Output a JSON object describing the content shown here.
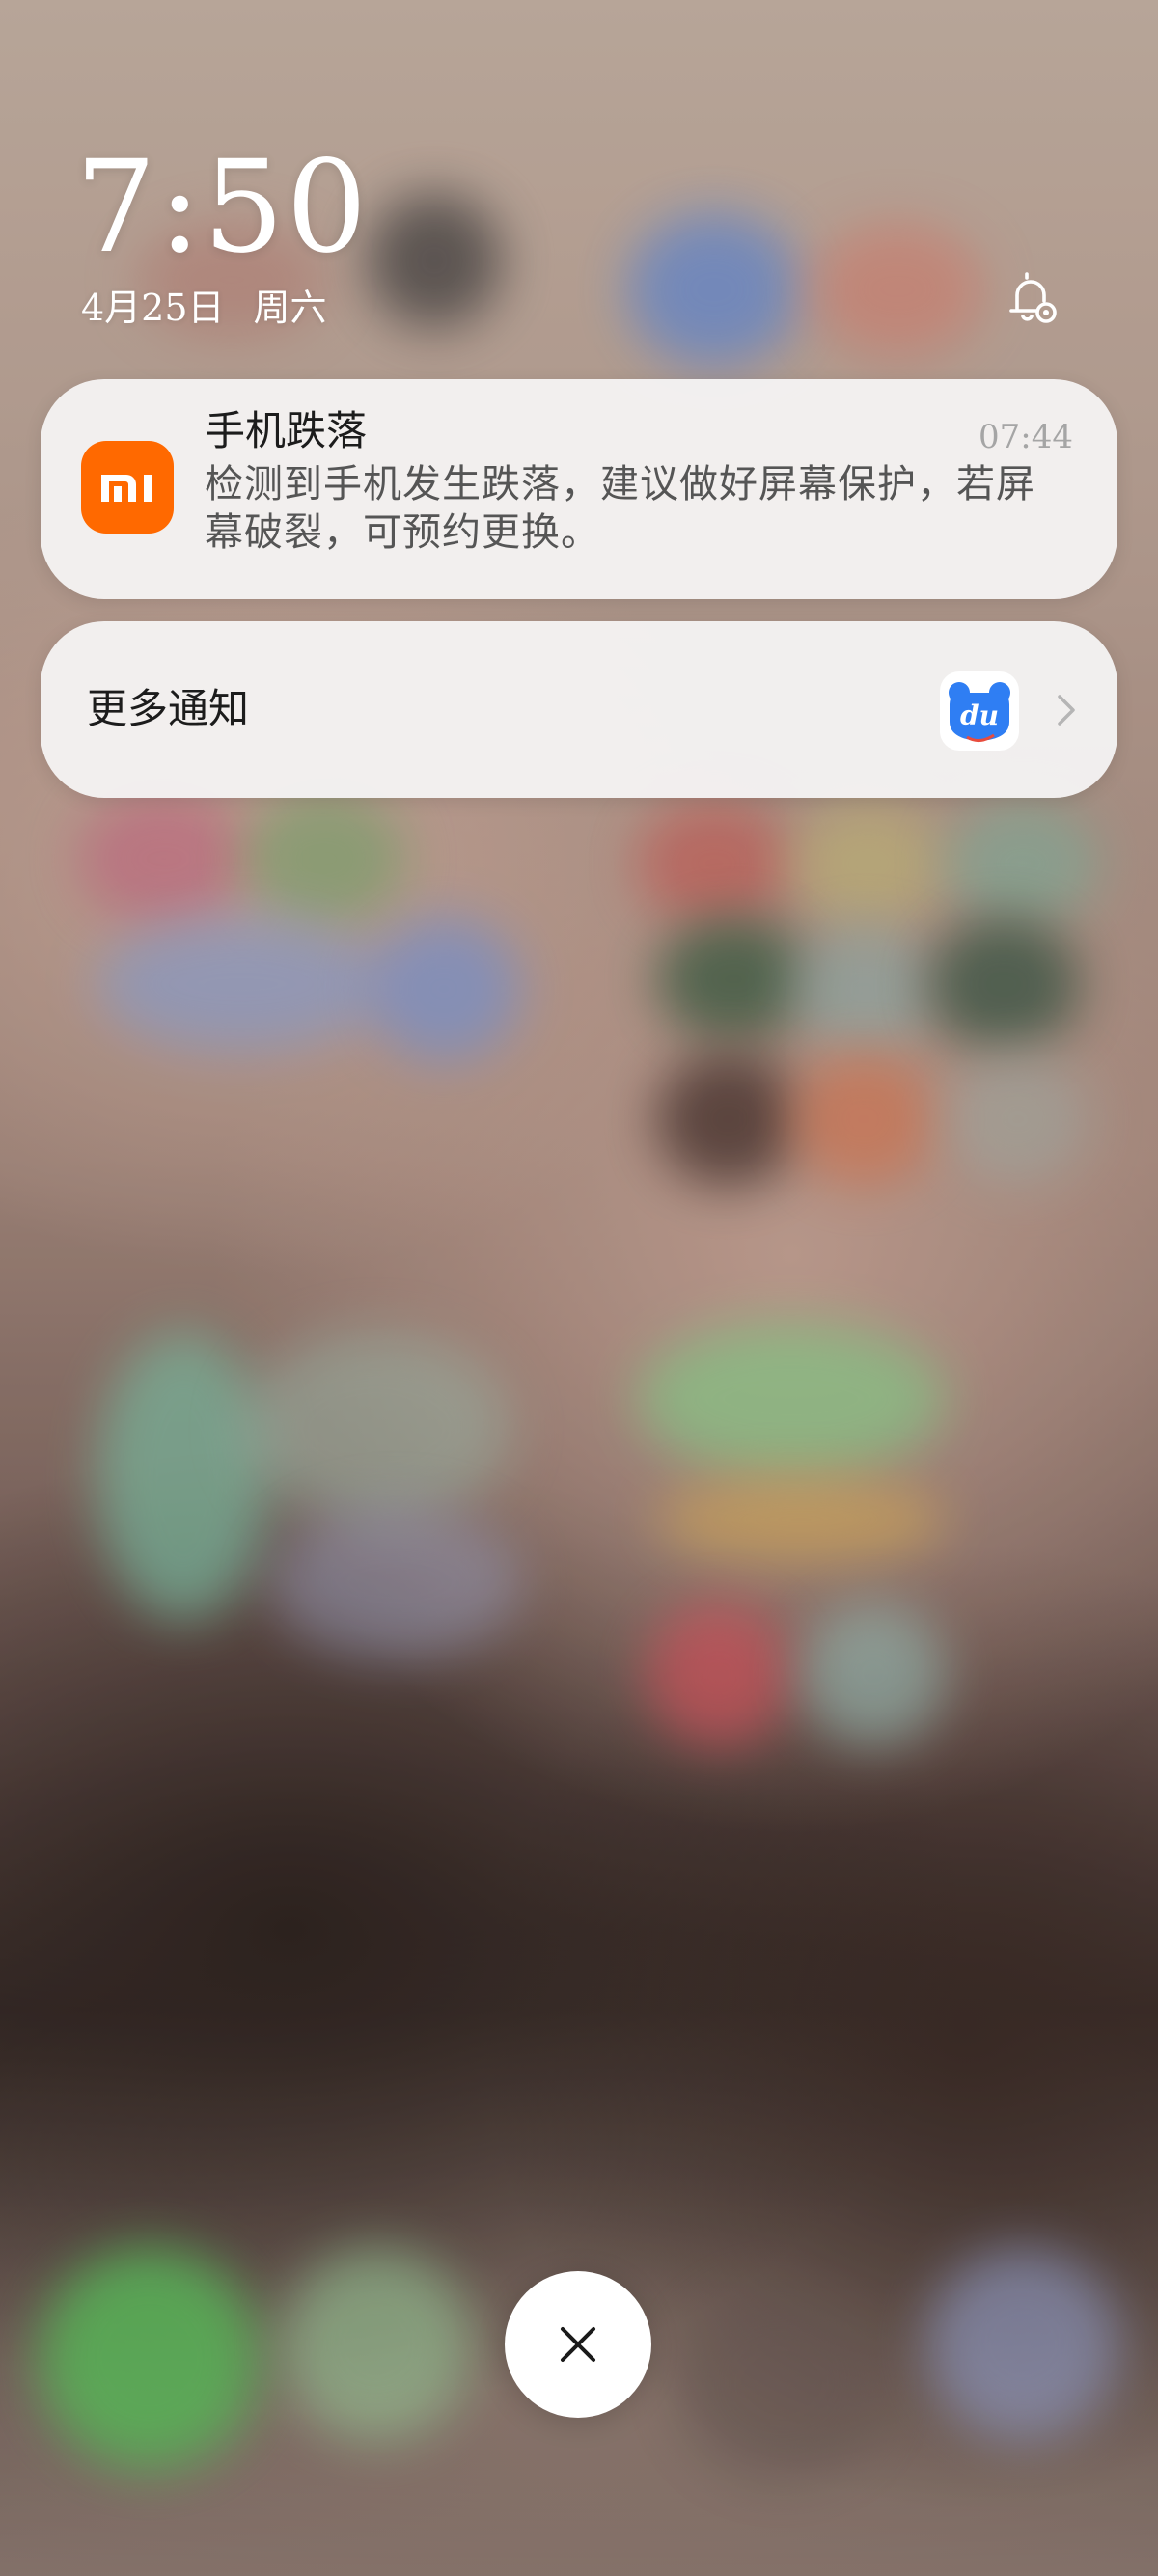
{
  "lockscreen": {
    "time": "7:50",
    "date": "4月25日",
    "weekday": "周六"
  },
  "notification": {
    "app": "Xiaomi",
    "app_icon": "mi-logo-icon",
    "title": "手机跌落",
    "time": "07:44",
    "body": "检测到手机发生跌落，建议做好屏幕保护，若屏幕破裂，可预约更换。"
  },
  "more_notifications": {
    "label": "更多通知",
    "app_icon": "baidu-du-icon",
    "chevron": "chevron-right-icon"
  },
  "controls": {
    "notification_settings_icon": "bell-settings-icon",
    "close_icon": "close-icon"
  },
  "colors": {
    "mi_orange": "#ff6900",
    "baidu_blue": "#2f7ef3",
    "card_bg": "#f4f2f2",
    "time_gray": "#a5a5a5"
  }
}
